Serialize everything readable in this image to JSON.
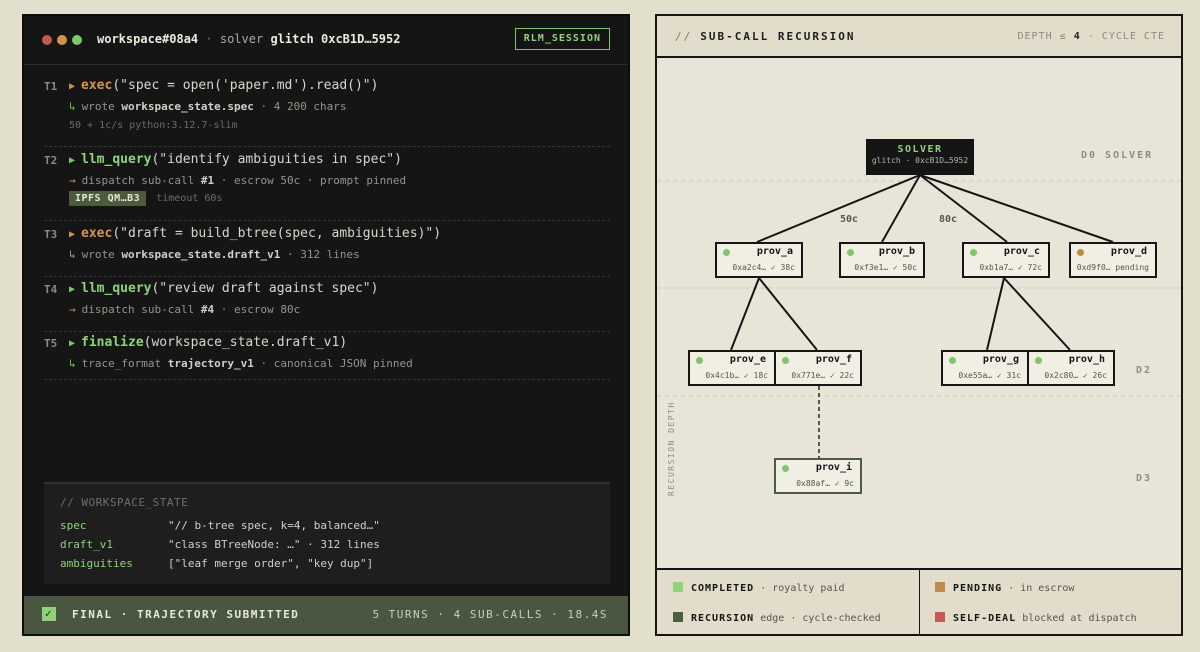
{
  "terminal": {
    "workspace": "workspace#08a4",
    "solver_label": "solver",
    "solver_id": "glitch 0xcB1D…5952",
    "session_badge": "RLM_SESSION",
    "turns": [
      {
        "id": "T1",
        "fn": "exec",
        "args": "(\"spec = open('paper.md').read()\")",
        "sub_prefix": "wrote",
        "sub_strong": "workspace_state.spec",
        "sub_rest": "· 4 200 chars",
        "meta": "50 + 1c/s   python:3.12.7-slim"
      },
      {
        "id": "T2",
        "fn": "llm_query",
        "args": "(\"identify ambiguities in spec\")",
        "sub_prefix": "dispatch sub-call",
        "sub_strong": "#1",
        "sub_rest": "· escrow 50c · prompt pinned",
        "badge": "IPFS QM…B3",
        "meta": "timeout 60s"
      },
      {
        "id": "T3",
        "fn": "exec",
        "args": "(\"draft = build_btree(spec, ambiguities)\")",
        "sub_prefix": "wrote",
        "sub_strong": "workspace_state.draft_v1",
        "sub_rest": "· 312 lines"
      },
      {
        "id": "T4",
        "fn": "llm_query",
        "args": "(\"review draft against spec\")",
        "sub_prefix": "dispatch sub-call",
        "sub_strong": "#4",
        "sub_rest": "· escrow 80c"
      },
      {
        "id": "T5",
        "fn": "finalize",
        "args": "(workspace_state.draft_v1)",
        "sub_prefix": "trace_format",
        "sub_strong": "trajectory_v1",
        "sub_rest": "· canonical JSON pinned"
      }
    ],
    "workspace_state": {
      "title": "// WORKSPACE_STATE",
      "rows": [
        {
          "k": "spec",
          "v": "\"// b-tree spec, k=4, balanced…\""
        },
        {
          "k": "draft_v1",
          "v": "\"class BTreeNode: …\" · 312 lines"
        },
        {
          "k": "ambiguities",
          "v": "[\"leaf merge order\", \"key dup\"]"
        }
      ]
    },
    "final": {
      "label": "FINAL · TRAJECTORY SUBMITTED",
      "stats": "5 TURNS · 4 SUB-CALLS · 18.4S"
    }
  },
  "panel": {
    "title_prefix": "//",
    "title": "SUB-CALL RECURSION",
    "depth_prefix": "DEPTH ≤",
    "depth_value": "4",
    "depth_suffix": "· CYCLE CTE",
    "depth_labels": [
      "D0 SOLVER",
      "D2",
      "D3"
    ],
    "recursion_label": "RECURSION DEPTH",
    "edge_labels": [
      "50c",
      "80c"
    ],
    "solver": {
      "title": "SOLVER",
      "sub": "glitch · 0xcB1D…5952"
    },
    "nodes": [
      {
        "id": "prov_a",
        "meta": "0xa2c4… ✓ 38c",
        "status": "completed"
      },
      {
        "id": "prov_b",
        "meta": "0xf3e1… ✓ 50c",
        "status": "completed"
      },
      {
        "id": "prov_c",
        "meta": "0xb1a7… ✓ 72c",
        "status": "completed"
      },
      {
        "id": "prov_d",
        "meta": "0xd9f0… pending",
        "status": "pending"
      },
      {
        "id": "prov_e",
        "meta": "0x4c1b… ✓ 18c",
        "status": "completed"
      },
      {
        "id": "prov_f",
        "meta": "0x771e… ✓ 22c",
        "status": "completed"
      },
      {
        "id": "prov_g",
        "meta": "0xe55a… ✓ 31c",
        "status": "completed"
      },
      {
        "id": "prov_h",
        "meta": "0x2c80… ✓ 26c",
        "status": "completed"
      },
      {
        "id": "prov_i",
        "meta": "0x88af… ✓ 9c",
        "status": "completed"
      }
    ],
    "legend": [
      {
        "label": "COMPLETED",
        "desc": "· royalty paid",
        "color": "#8fd27a"
      },
      {
        "label": "PENDING",
        "desc": "· in escrow",
        "color": "#c08a4a"
      },
      {
        "label": "RECURSION",
        "desc": "edge · cycle-checked",
        "color": "#4f5c45"
      },
      {
        "label": "SELF-DEAL",
        "desc": "blocked at dispatch",
        "color": "#c25a5a"
      }
    ]
  },
  "colors": {
    "accent_green": "#8fd27a",
    "accent_orange": "#d9934e",
    "terminal_bg": "#151515",
    "panel_bg": "#e8e5d8"
  }
}
